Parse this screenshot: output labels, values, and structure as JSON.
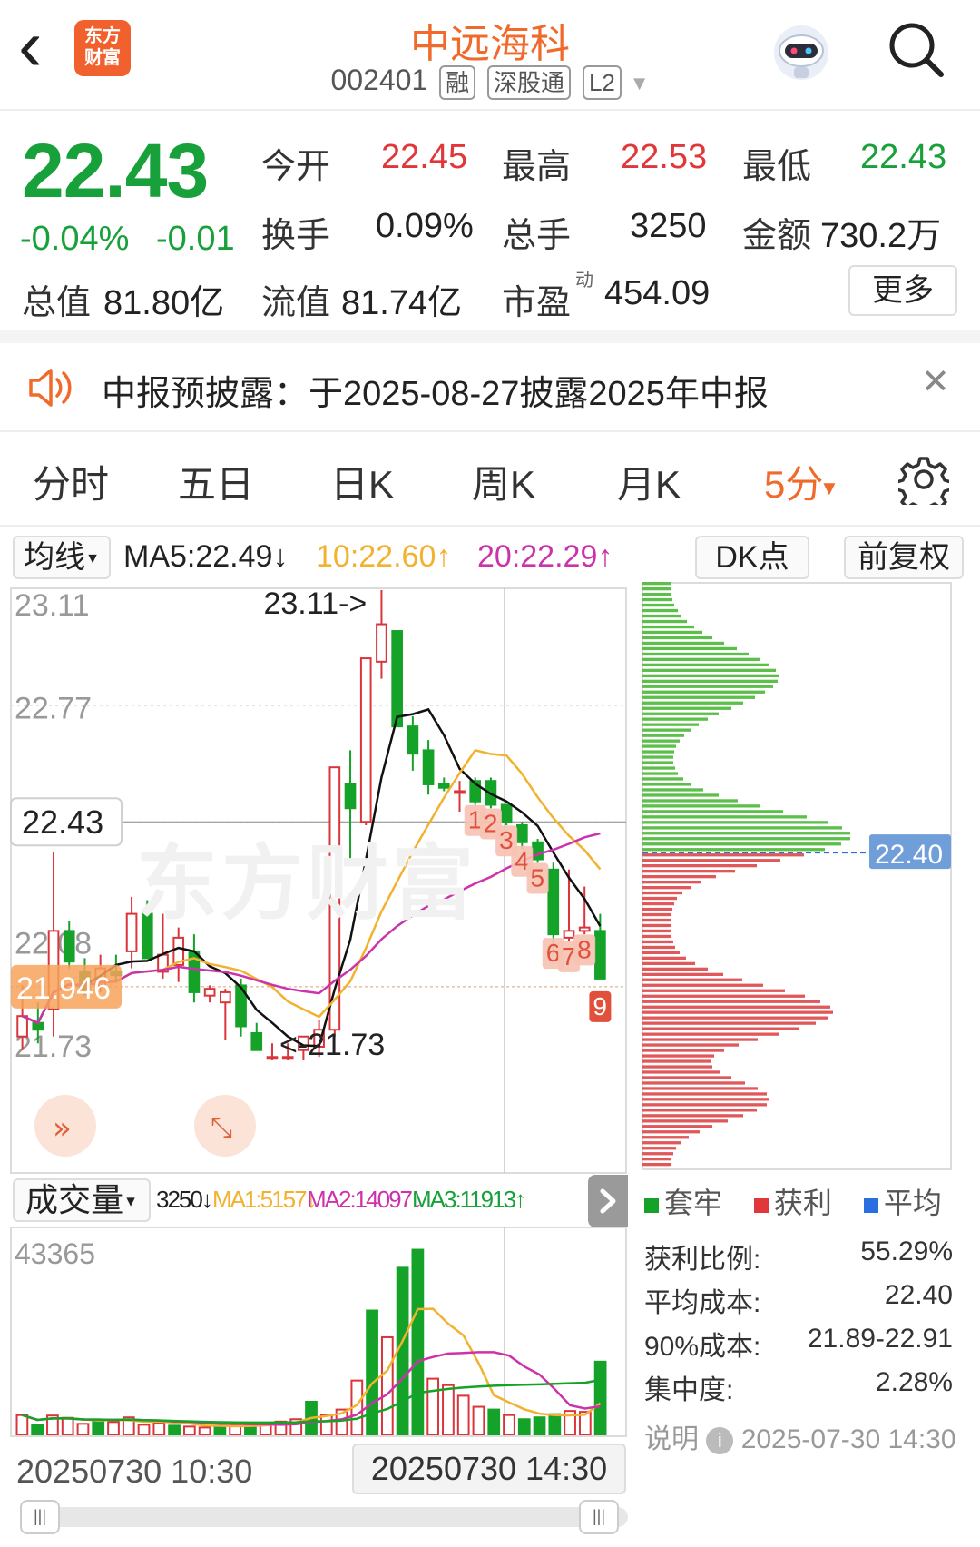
{
  "header": {
    "back_glyph": "‹",
    "logo_line1": "东方",
    "logo_line2": "财富",
    "stock_name": "中远海科",
    "stock_code": "002401",
    "tags": [
      "融",
      "深股通",
      "L2"
    ],
    "dropdown_glyph": "▼"
  },
  "quote": {
    "price": "22.43",
    "change_pct": "-0.04%",
    "change": "-0.01",
    "open_label": "今开",
    "open": "22.45",
    "high_label": "最高",
    "high": "22.53",
    "low_label": "最低",
    "low": "22.43",
    "turnover_label": "换手",
    "turnover": "0.09%",
    "volume_label": "总手",
    "volume": "3250",
    "amount_label": "金额",
    "amount": "730.2万",
    "mktcap_label": "总值",
    "mktcap": "81.80亿",
    "float_label": "流值",
    "float": "81.74亿",
    "pe_label": "市盈",
    "pe_sup": "动",
    "pe": "454.09",
    "more_label": "更多"
  },
  "notice": {
    "text": "中报预披露：于2025-08-27披露2025年中报",
    "close_glyph": "✕"
  },
  "tabs": {
    "items": [
      "分时",
      "五日",
      "日K",
      "周K",
      "月K",
      "5分"
    ],
    "active_index": 5,
    "active_arrow": "▾"
  },
  "kline": {
    "ma_select": "均线",
    "ma5": "MA5:22.49↓",
    "ma10": "10:22.60↑",
    "ma20": "20:22.29↑",
    "dk_button": "DK点",
    "fq_button": "前复权",
    "y_labels": [
      "23.11",
      "22.77",
      "22.43",
      "22.08",
      "21.73"
    ],
    "current_price_label": "22.43",
    "avg_cost_label": "21.946",
    "max_annotation": "23.11->",
    "min_annotation": "<-21.73",
    "td_labels": [
      "1",
      "2",
      "3",
      "4",
      "5",
      "6",
      "7",
      "8",
      "9"
    ],
    "watermark": "东方财富",
    "colors": {
      "up": "#d9353a",
      "down": "#14a328",
      "ma5": "#111111",
      "ma10": "#f2b230",
      "ma20": "#cc33aa"
    }
  },
  "chart_data": {
    "type": "candlestick",
    "interval": "5分",
    "ylim": [
      21.73,
      23.11
    ],
    "candles": [
      {
        "o": 21.8,
        "h": 21.95,
        "l": 21.76,
        "c": 21.86
      },
      {
        "o": 21.84,
        "h": 21.9,
        "l": 21.78,
        "c": 21.82
      },
      {
        "o": 21.88,
        "h": 22.34,
        "l": 21.8,
        "c": 22.11
      },
      {
        "o": 22.11,
        "h": 22.14,
        "l": 22.0,
        "c": 22.02
      },
      {
        "o": 21.99,
        "h": 22.03,
        "l": 21.92,
        "c": 21.94
      },
      {
        "o": 21.95,
        "h": 22.04,
        "l": 21.93,
        "c": 22.0
      },
      {
        "o": 21.99,
        "h": 22.04,
        "l": 21.96,
        "c": 21.98
      },
      {
        "o": 22.05,
        "h": 22.21,
        "l": 22.0,
        "c": 22.16
      },
      {
        "o": 22.16,
        "h": 22.2,
        "l": 22.04,
        "c": 22.03
      },
      {
        "o": 21.99,
        "h": 22.16,
        "l": 21.97,
        "c": 22.04
      },
      {
        "o": 22.01,
        "h": 22.12,
        "l": 21.96,
        "c": 22.09
      },
      {
        "o": 22.05,
        "h": 22.1,
        "l": 21.9,
        "c": 21.93
      },
      {
        "o": 21.92,
        "h": 21.95,
        "l": 21.9,
        "c": 21.94
      },
      {
        "o": 21.9,
        "h": 21.94,
        "l": 21.79,
        "c": 21.93
      },
      {
        "o": 21.95,
        "h": 21.97,
        "l": 21.8,
        "c": 21.83
      },
      {
        "o": 21.81,
        "h": 21.84,
        "l": 21.76,
        "c": 21.76
      },
      {
        "o": 21.74,
        "h": 21.78,
        "l": 21.73,
        "c": 21.74
      },
      {
        "o": 21.74,
        "h": 21.78,
        "l": 21.73,
        "c": 21.74
      },
      {
        "o": 21.76,
        "h": 21.8,
        "l": 21.73,
        "c": 21.8
      },
      {
        "o": 21.77,
        "h": 21.85,
        "l": 21.74,
        "c": 21.82
      },
      {
        "o": 21.82,
        "h": 22.56,
        "l": 21.8,
        "c": 22.59
      },
      {
        "o": 22.54,
        "h": 22.64,
        "l": 22.32,
        "c": 22.47
      },
      {
        "o": 22.43,
        "h": 22.91,
        "l": 22.42,
        "c": 22.91
      },
      {
        "o": 22.9,
        "h": 23.11,
        "l": 22.85,
        "c": 23.01
      },
      {
        "o": 22.99,
        "h": 22.99,
        "l": 22.71,
        "c": 22.71
      },
      {
        "o": 22.71,
        "h": 22.74,
        "l": 22.58,
        "c": 22.63
      },
      {
        "o": 22.64,
        "h": 22.67,
        "l": 22.51,
        "c": 22.54
      },
      {
        "o": 22.54,
        "h": 22.56,
        "l": 22.52,
        "c": 22.53
      },
      {
        "o": 22.52,
        "h": 22.55,
        "l": 22.46,
        "c": 22.52
      },
      {
        "o": 22.55,
        "h": 22.56,
        "l": 22.48,
        "c": 22.49
      },
      {
        "o": 22.55,
        "h": 22.56,
        "l": 22.47,
        "c": 22.48
      },
      {
        "o": 22.48,
        "h": 22.48,
        "l": 22.42,
        "c": 22.43
      },
      {
        "o": 22.42,
        "h": 22.43,
        "l": 22.35,
        "c": 22.37
      },
      {
        "o": 22.37,
        "h": 22.38,
        "l": 22.31,
        "c": 22.32
      },
      {
        "o": 22.29,
        "h": 22.31,
        "l": 22.04,
        "c": 22.1
      },
      {
        "o": 22.09,
        "h": 22.29,
        "l": 22.08,
        "c": 22.11
      },
      {
        "o": 22.11,
        "h": 22.24,
        "l": 22.1,
        "c": 22.12
      },
      {
        "o": 22.11,
        "h": 22.16,
        "l": 21.97,
        "c": 21.97
      }
    ],
    "ma5_desc": "MA5:22.49↓",
    "volume": {
      "label": "成交量",
      "current": "3250↓",
      "ma1": "MA1:5157↓",
      "ma2": "MA2:14097↓",
      "ma3": "MA3:11913↑",
      "max_label": "43365",
      "ymax": 43365,
      "bars": [
        4200,
        2100,
        4100,
        3600,
        2300,
        3100,
        2700,
        3700,
        2100,
        2500,
        1900,
        1700,
        1500,
        1800,
        2000,
        2100,
        2500,
        2800,
        3300,
        7100,
        4300,
        5400,
        11700,
        26900,
        21100,
        36200,
        40100,
        12100,
        10700,
        8400,
        6000,
        5400,
        4200,
        3300,
        3700,
        4400,
        5100,
        4900,
        15800
      ],
      "bar_up": [
        true,
        false,
        true,
        true,
        true,
        false,
        true,
        true,
        true,
        true,
        false,
        true,
        true,
        false,
        true,
        false,
        true,
        true,
        true,
        false,
        true,
        true,
        true,
        false,
        true,
        false,
        false,
        true,
        true,
        true,
        true,
        false,
        true,
        false,
        false,
        false,
        true,
        true,
        false
      ]
    },
    "x_labels": [
      "20250730 10:30",
      "20250730 14:30"
    ],
    "chip_distribution": {
      "current": "22.40",
      "legend": [
        "套牢",
        "获利",
        "平均"
      ],
      "profit_ratio_label": "获利比例:",
      "profit_ratio": "55.29%",
      "avg_cost_label": "平均成本:",
      "avg_cost": "22.40",
      "cost90_label": "90%成本:",
      "cost90": "21.89-22.91",
      "concentration_label": "集中度:",
      "concentration": "2.28%",
      "note_label": "说明",
      "note_date": "2025-07-30 14:30"
    }
  }
}
